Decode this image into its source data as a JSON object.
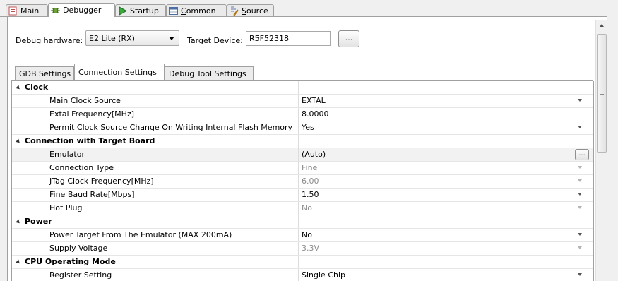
{
  "top_tabs": [
    {
      "label": "Main",
      "icon": "main-tab-icon"
    },
    {
      "label": "Debugger",
      "icon": "debugger-bug-icon"
    },
    {
      "label": "Startup",
      "icon": "startup-play-icon"
    },
    {
      "label_underlined": "C",
      "label_rest": "ommon",
      "icon": "common-icon"
    },
    {
      "label_underlined": "S",
      "label_rest": "ource",
      "icon": "source-icon"
    }
  ],
  "debug_hardware": {
    "label": "Debug hardware:",
    "value": "E2 Lite (RX)"
  },
  "target_device": {
    "label": "Target Device:",
    "value": "R5F52318",
    "browse_label": "..."
  },
  "inner_tabs": [
    "GDB Settings",
    "Connection Settings",
    "Debug Tool Settings"
  ],
  "rows": [
    {
      "key": "Clock",
      "value": ""
    },
    {
      "key": "Main Clock Source",
      "value": "EXTAL"
    },
    {
      "key": "Extal Frequency[MHz]",
      "value": "8.0000"
    },
    {
      "key": "Permit Clock Source Change On Writing Internal Flash Memory",
      "value": "Yes"
    },
    {
      "key": "Connection with Target Board",
      "value": ""
    },
    {
      "key": "Emulator",
      "value": "(Auto)",
      "button": "..."
    },
    {
      "key": "Connection Type",
      "value": "Fine"
    },
    {
      "key": "JTag Clock Frequency[MHz]",
      "value": "6.00"
    },
    {
      "key": "Fine Baud Rate[Mbps]",
      "value": "1.50"
    },
    {
      "key": "Hot Plug",
      "value": "No"
    },
    {
      "key": "Power",
      "value": ""
    },
    {
      "key": "Power Target From The Emulator (MAX 200mA)",
      "value": "No"
    },
    {
      "key": "Supply Voltage",
      "value": "3.3V"
    },
    {
      "key": "CPU Operating Mode",
      "value": ""
    },
    {
      "key": "Register Setting",
      "value": "Single Chip"
    }
  ]
}
